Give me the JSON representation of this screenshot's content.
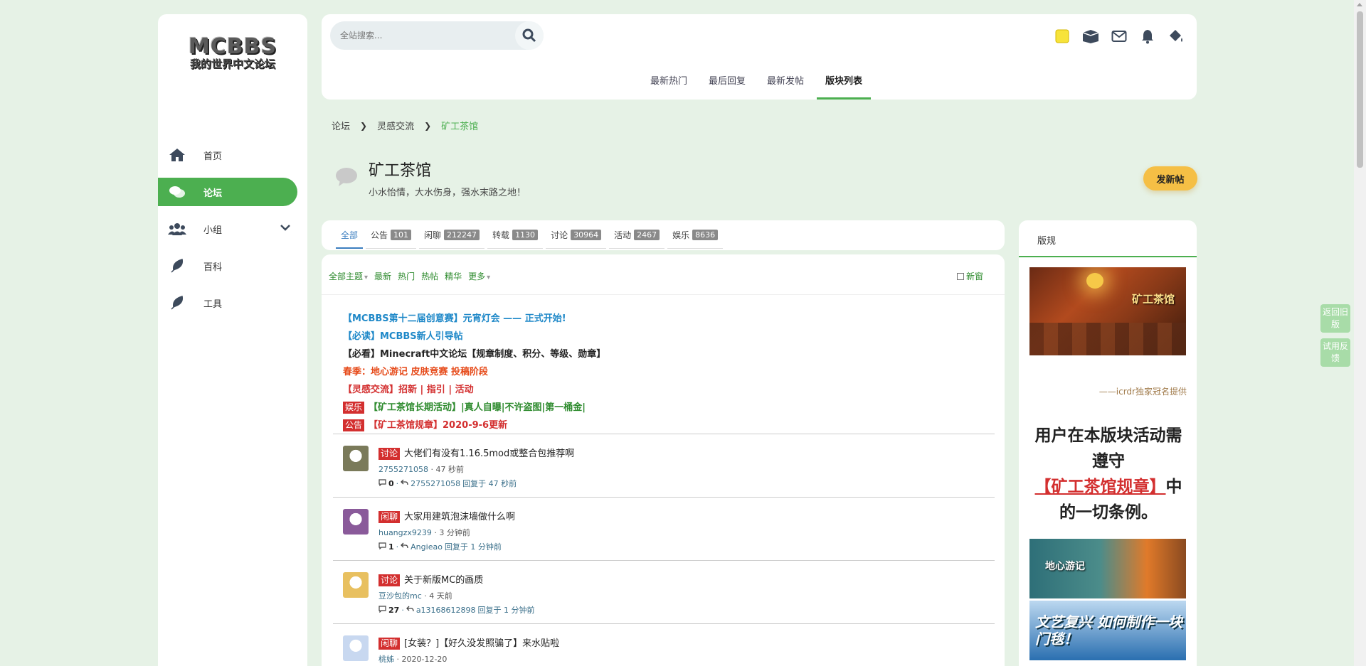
{
  "sidebar": {
    "logo": {
      "line1": "MCBBS",
      "line2": "我的世界中文论坛"
    },
    "items": [
      {
        "label": "首页",
        "icon": "home-icon"
      },
      {
        "label": "论坛",
        "icon": "chat-icon"
      },
      {
        "label": "小组",
        "icon": "users-icon"
      },
      {
        "label": "百科",
        "icon": "feather-icon"
      },
      {
        "label": "工具",
        "icon": "feather-icon"
      }
    ]
  },
  "header": {
    "search_placeholder": "全站搜索...",
    "tabs": [
      "最新热门",
      "最后回复",
      "最新发帖",
      "版块列表"
    ],
    "active_tab": "版块列表"
  },
  "breadcrumb": [
    "论坛",
    "灵感交流",
    "矿工茶馆"
  ],
  "forum": {
    "title": "矿工茶馆",
    "description": "小水怡情，大水伤身，强水末路之地！",
    "new_post_label": "发新帖"
  },
  "type_tabs": [
    {
      "label": "全部",
      "count": ""
    },
    {
      "label": "公告",
      "count": "101"
    },
    {
      "label": "闲聊",
      "count": "212247"
    },
    {
      "label": "转载",
      "count": "1130"
    },
    {
      "label": "讨论",
      "count": "30964"
    },
    {
      "label": "活动",
      "count": "2467"
    },
    {
      "label": "娱乐",
      "count": "8636"
    }
  ],
  "filters": {
    "items": [
      "全部主题",
      "最新",
      "热门",
      "热帖",
      "精华",
      "更多"
    ],
    "new_window": "新窗"
  },
  "announcements": [
    {
      "text": "【MCBBS第十二届创意赛】元宵灯会 —— 正式开始!",
      "badge": "",
      "color": "#1e88c8"
    },
    {
      "text": "【必读】MCBBS新人引导帖",
      "badge": "",
      "color": "#1e88c8"
    },
    {
      "text": "【必看】Minecraft中文论坛【规章制度、积分、等级、勋章】",
      "badge": "",
      "color": "#222222"
    },
    {
      "text": "春季：地心游记 皮肤竞赛 投稿阶段",
      "badge": "",
      "color": "#e64a19"
    },
    {
      "text": "【灵感交流】招新 | 指引 | 活动",
      "badge": "",
      "color": "#d32f2f"
    },
    {
      "text": "【矿工茶馆长期活动】|真人自曝|不许盗图|第一桶金|",
      "badge": "娱乐",
      "color": "#2e8b2e"
    },
    {
      "text": "【矿工茶馆规章】2020-9-6更新",
      "badge": "公告",
      "color": "#d32f2f"
    }
  ],
  "threads": [
    {
      "badge": "讨论",
      "title": "大佬们有没有1.16.5mod或整合包推荐啊",
      "author": "2755271058",
      "time": "47 秒前",
      "replies": "0",
      "last_user": "2755271058",
      "reply_text": "回复于 47 秒前",
      "avatar_color": "#7a7a5a"
    },
    {
      "badge": "闲聊",
      "title": "大家用建筑泡沫墙做什么啊",
      "author": "huangzx9239",
      "time": "3 分钟前",
      "replies": "1",
      "last_user": "Angieao",
      "reply_text": "回复于 1 分钟前",
      "avatar_color": "#8a5a9a"
    },
    {
      "badge": "讨论",
      "title": "关于新版MC的画质",
      "author": "豆沙包的mc",
      "time": "4 天前",
      "replies": "27",
      "last_user": "a13168612898",
      "reply_text": "回复于 1 分钟前",
      "avatar_color": "#e8c060"
    },
    {
      "badge": "闲聊",
      "title": "[女装？]【好久没发照骗了】来水贴啦",
      "author": "桃姊",
      "time": "2020-12-20",
      "replies": "",
      "last_user": "",
      "reply_text": "",
      "avatar_color": "#c8d8f0"
    }
  ],
  "rules": {
    "tab_label": "版规",
    "banner_title": "矿工茶馆",
    "credit": "——icrdr独家冠名提供",
    "note_before": "用户在本版块活动需遵守",
    "note_link": "【矿工茶馆规章】",
    "note_after": "中的一切条例。",
    "banner2_title": "地心游记",
    "banner3_title": "文艺复兴 如何制作一块门毯！"
  },
  "side_buttons": [
    "返回旧版",
    "试用反馈"
  ],
  "colors": {
    "accent": "#4caf50",
    "badge": "#d32f2f",
    "new_post": "#f5bf45"
  }
}
